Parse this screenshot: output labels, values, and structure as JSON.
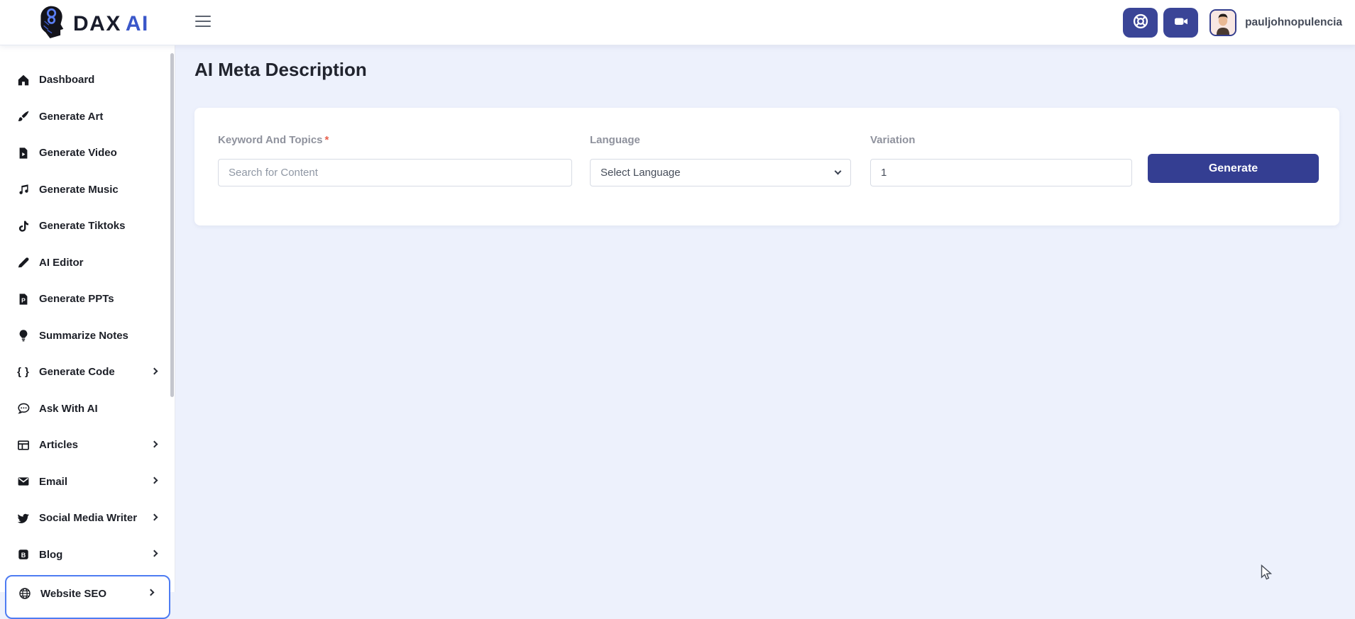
{
  "app": {
    "brand_primary": "DAX",
    "brand_secondary": "AI",
    "username": "pauljohnopulencia"
  },
  "header": {
    "icons": [
      "hamburger-menu-icon",
      "lifebuoy-support-icon",
      "video-camera-icon",
      "user-avatar"
    ]
  },
  "sidebar": {
    "items": [
      {
        "label": "Dashboard",
        "icon": "home-icon",
        "has_submenu": false,
        "active": false
      },
      {
        "label": "Generate Art",
        "icon": "paintbrush-icon",
        "has_submenu": false,
        "active": false
      },
      {
        "label": "Generate Video",
        "icon": "video-file-icon",
        "has_submenu": false,
        "active": false
      },
      {
        "label": "Generate Music",
        "icon": "music-notes-icon",
        "has_submenu": false,
        "active": false
      },
      {
        "label": "Generate Tiktoks",
        "icon": "tiktok-icon",
        "has_submenu": false,
        "active": false
      },
      {
        "label": "AI Editor",
        "icon": "pen-icon",
        "has_submenu": false,
        "active": false
      },
      {
        "label": "Generate PPTs",
        "icon": "ppt-file-icon",
        "has_submenu": false,
        "active": false
      },
      {
        "label": "Summarize Notes",
        "icon": "lightbulb-icon",
        "has_submenu": false,
        "active": false
      },
      {
        "label": "Generate Code",
        "icon": "code-braces-icon",
        "has_submenu": true,
        "active": false
      },
      {
        "label": "Ask With AI",
        "icon": "chat-bubble-icon",
        "has_submenu": false,
        "active": false
      },
      {
        "label": "Articles",
        "icon": "table-icon",
        "has_submenu": true,
        "active": false
      },
      {
        "label": "Email",
        "icon": "envelope-icon",
        "has_submenu": true,
        "active": false
      },
      {
        "label": "Social Media Writer",
        "icon": "twitter-bird-icon",
        "has_submenu": true,
        "active": false
      },
      {
        "label": "Blog",
        "icon": "blog-icon",
        "has_submenu": true,
        "active": false
      },
      {
        "label": "Website SEO",
        "icon": "globe-icon",
        "has_submenu": true,
        "active": true
      }
    ]
  },
  "main": {
    "title": "AI Meta Description",
    "form": {
      "keyword_label": "Keyword And Topics",
      "required_mark": "*",
      "keyword_placeholder": "Search for Content",
      "language_label": "Language",
      "language_value": "Select Language",
      "variation_label": "Variation",
      "variation_value": "1",
      "generate_label": "Generate"
    }
  },
  "colors": {
    "accent_indigo": "#3a4597",
    "generate_button": "#343e92",
    "active_item_border": "#4e7cf2",
    "main_background": "#edf1fc",
    "required_asterisk": "#e8604c"
  }
}
